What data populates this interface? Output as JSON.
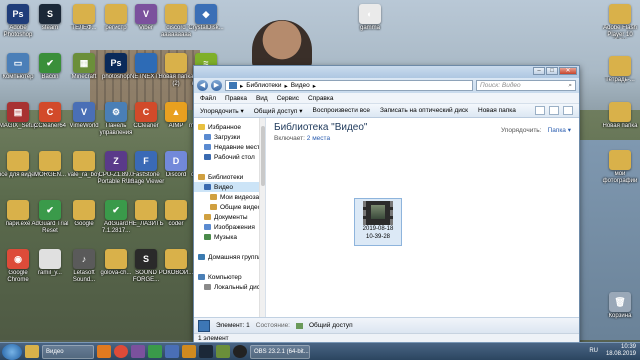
{
  "desktop_icons": [
    {
      "label": "Adobe Photoshop",
      "color": "#1f3d7a",
      "glyph": "Ps"
    },
    {
      "label": "steam",
      "color": "#1b2838",
      "glyph": "S"
    },
    {
      "label": "ТЕЛЕФ...",
      "color": "#d9b14a",
      "glyph": ""
    },
    {
      "label": "регистр",
      "color": "#d9b14a",
      "glyph": ""
    },
    {
      "label": "Viber",
      "color": "#7b519d",
      "glyph": "V"
    },
    {
      "label": "discord ааааааааа",
      "color": "#d9b14a",
      "glyph": ""
    },
    {
      "label": "CrystalDisk...",
      "color": "#3b6fb6",
      "glyph": "◆"
    },
    {
      "label": "Компьютер",
      "color": "#4b7fb8",
      "glyph": "▭"
    },
    {
      "label": "Bacon",
      "color": "#3a8f3a",
      "glyph": "✔"
    },
    {
      "label": "Minecraft",
      "color": "#6b8f3a",
      "glyph": "▦"
    },
    {
      "label": "photoshop",
      "color": "#0a2a5a",
      "glyph": "Ps"
    },
    {
      "label": "NETNEXTS",
      "color": "#2d6bb6",
      "glyph": ""
    },
    {
      "label": "Новая папка (2)",
      "color": "#d9b14a",
      "glyph": ""
    },
    {
      "label": "Утилита настройки",
      "color": "#7fb02a",
      "glyph": "≈"
    },
    {
      "label": "MAGIX_Setup",
      "color": "#a83232",
      "glyph": "▤"
    },
    {
      "label": "CCleaner64",
      "color": "#d24a2a",
      "glyph": "C"
    },
    {
      "label": "VimeWorld",
      "color": "#4a6fb6",
      "glyph": "V"
    },
    {
      "label": "Панель управления",
      "color": "#4a7fb6",
      "glyph": "⚙"
    },
    {
      "label": "CCleaner",
      "color": "#d24a2a",
      "glyph": "C"
    },
    {
      "label": "AIMP",
      "color": "#e8a020",
      "glyph": "▲"
    },
    {
      "label": "muzmoney...",
      "color": "#d9b14a",
      "glyph": ""
    },
    {
      "label": "все для видео",
      "color": "#d9b14a",
      "glyph": ""
    },
    {
      "label": "MORGEN...",
      "color": "#d9b14a",
      "glyph": ""
    },
    {
      "label": "vale_ra_boy",
      "color": "#d9b14a",
      "glyph": ""
    },
    {
      "label": "CPU-Z1.89.0 Portable RUS",
      "color": "#5a3a8a",
      "glyph": "Z"
    },
    {
      "label": "FastStone Image Viewer",
      "color": "#3a6ab6",
      "glyph": "F"
    },
    {
      "label": "Discord",
      "color": "#7289da",
      "glyph": "D"
    },
    {
      "label": "сборка м...",
      "color": "#d9b14a",
      "glyph": ""
    },
    {
      "label": "пари.exe",
      "color": "#d9b14a",
      "glyph": ""
    },
    {
      "label": "AdGuard Trial Reset",
      "color": "#3a9a4a",
      "glyph": "✔"
    },
    {
      "label": "Google",
      "color": "#d9b14a",
      "glyph": ""
    },
    {
      "label": "AdGuard 7.1.2817...",
      "color": "#3a9a4a",
      "glyph": "✔"
    },
    {
      "label": "НЕ_ЛАЗИТЬ",
      "color": "#d9b14a",
      "glyph": ""
    },
    {
      "label": "coder",
      "color": "#d9b14a",
      "glyph": ""
    },
    {
      "label": "Crack",
      "color": "#d9b14a",
      "glyph": ""
    },
    {
      "label": "Google Chrome",
      "color": "#dd4b39",
      "glyph": "◉"
    },
    {
      "label": "ramil_y...",
      "color": "#e0e0e0",
      "glyph": ""
    },
    {
      "label": "Letasoft Sound...",
      "color": "#5a5a5a",
      "glyph": "♪"
    },
    {
      "label": "golova-ch...",
      "color": "#d9b14a",
      "glyph": ""
    },
    {
      "label": "SOUND FORGE...",
      "color": "#2a2a2a",
      "glyph": "S"
    },
    {
      "label": "РОКОВОЙ...",
      "color": "#d9b14a",
      "glyph": ""
    }
  ],
  "right_icons": [
    {
      "label": "gamma",
      "color": "#eaeaea",
      "glyph": "◐"
    },
    {
      "label": "Adobe Flash Player 10 OCX",
      "color": "#d9b14a",
      "glyph": ""
    },
    {
      "label": "Тетрадь-...",
      "color": "#d9b14a",
      "glyph": ""
    },
    {
      "label": "Новая папка",
      "color": "#d9b14a",
      "glyph": ""
    },
    {
      "label": "мои фотографии",
      "color": "#d9b14a",
      "glyph": ""
    },
    {
      "label": "Корзина",
      "color": "#9aa8b8",
      "glyph": "🗑"
    }
  ],
  "window": {
    "address": [
      "Библиотеки",
      "Видео"
    ],
    "search_placeholder": "Поиск: Видео",
    "menu": [
      "Файл",
      "Правка",
      "Вид",
      "Сервис",
      "Справка"
    ],
    "toolbar": [
      "Упорядочить ▾",
      "Общий доступ ▾",
      "Воспроизвести все",
      "Записать на оптический диск",
      "Новая папка"
    ],
    "nav": [
      {
        "label": "Избранное",
        "color": "#e8c040",
        "indent": 0
      },
      {
        "label": "Загрузки",
        "color": "#5a8ad0",
        "indent": 1
      },
      {
        "label": "Недавние места",
        "color": "#5a8ad0",
        "indent": 1
      },
      {
        "label": "Рабочий стол",
        "color": "#3a6ab0",
        "indent": 1
      },
      {
        "label": "",
        "color": "",
        "indent": 0
      },
      {
        "label": "Библиотеки",
        "color": "#d0a040",
        "indent": 0
      },
      {
        "label": "Видео",
        "color": "#3a6ab0",
        "indent": 1
      },
      {
        "label": "Мои видеозаписи",
        "color": "#d0a040",
        "indent": 2
      },
      {
        "label": "Общие видео",
        "color": "#d0a040",
        "indent": 2
      },
      {
        "label": "Документы",
        "color": "#d0a040",
        "indent": 1
      },
      {
        "label": "Изображения",
        "color": "#5a8ad0",
        "indent": 1
      },
      {
        "label": "Музыка",
        "color": "#4a8a4a",
        "indent": 1
      },
      {
        "label": "",
        "color": "",
        "indent": 0
      },
      {
        "label": "Домашняя группа",
        "color": "#3a7ab0",
        "indent": 0
      },
      {
        "label": "",
        "color": "",
        "indent": 0
      },
      {
        "label": "Компьютер",
        "color": "#4a7fb6",
        "indent": 0
      },
      {
        "label": "Локальный диск",
        "color": "#8a8a8a",
        "indent": 1
      }
    ],
    "library_title": "Библиотека \"Видео\"",
    "includes_label": "Включает:",
    "includes_link": "2 места",
    "arrange_label": "Упорядочить:",
    "arrange_value": "Папка ▾",
    "file_name_line1": "2019-08-18",
    "file_name_line2": "10-39-28",
    "details_elements": "Элемент: 1",
    "details_state_label": "Состояние:",
    "details_state_value": "Общий доступ",
    "status": "1 элемент"
  },
  "taskbar": {
    "explorer_label": "Видео",
    "obs_label": "OBS 23.2.1 (64-bit...",
    "lang": "RU",
    "time": "10:39",
    "date": "18.08.2019"
  }
}
